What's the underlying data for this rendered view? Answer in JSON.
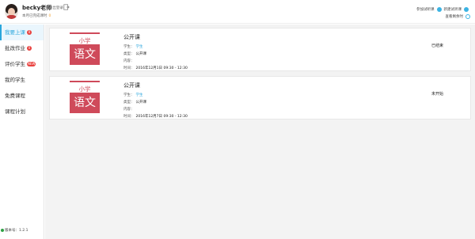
{
  "header": {
    "teacher_name": "becky老师",
    "logout_label": "退出登录",
    "month_label": "本月已完成课时",
    "month_count": "0",
    "link1": "参加试听课",
    "link2": "新建试听课",
    "link3": "查看剩余时"
  },
  "sidebar": {
    "items": [
      {
        "label": "我要上课",
        "badge": "0",
        "active": true
      },
      {
        "label": "批改作业",
        "badge": "0"
      },
      {
        "label": "评价学生",
        "badge": "NEW"
      },
      {
        "label": "我的学生"
      },
      {
        "label": "免费课程"
      },
      {
        "label": "课程计划"
      }
    ],
    "version": "版本号：1.2.1"
  },
  "cards": [
    {
      "cover_top": "小学",
      "cover_main": "语文",
      "title": "公开课",
      "student_label": "学生：",
      "student_value": "学生",
      "type_label": "类型：",
      "type_value": "公开课",
      "content_label": "内容：",
      "content_value": "",
      "time_label": "时间：",
      "time_value": "2016年12月1日 09:30 - 12:30",
      "status": "已结束"
    },
    {
      "cover_top": "小学",
      "cover_main": "语文",
      "title": "公开课",
      "student_label": "学生：",
      "student_value": "学生",
      "type_label": "类型：",
      "type_value": "公开课",
      "content_label": "内容：",
      "content_value": "",
      "time_label": "时间：",
      "time_value": "2016年12月7日 09:30 - 12:30",
      "status": "未开始"
    }
  ],
  "colors": {
    "accent": "#2aa6dc",
    "badge": "#e9413e",
    "cover": "#cf4a5a"
  }
}
